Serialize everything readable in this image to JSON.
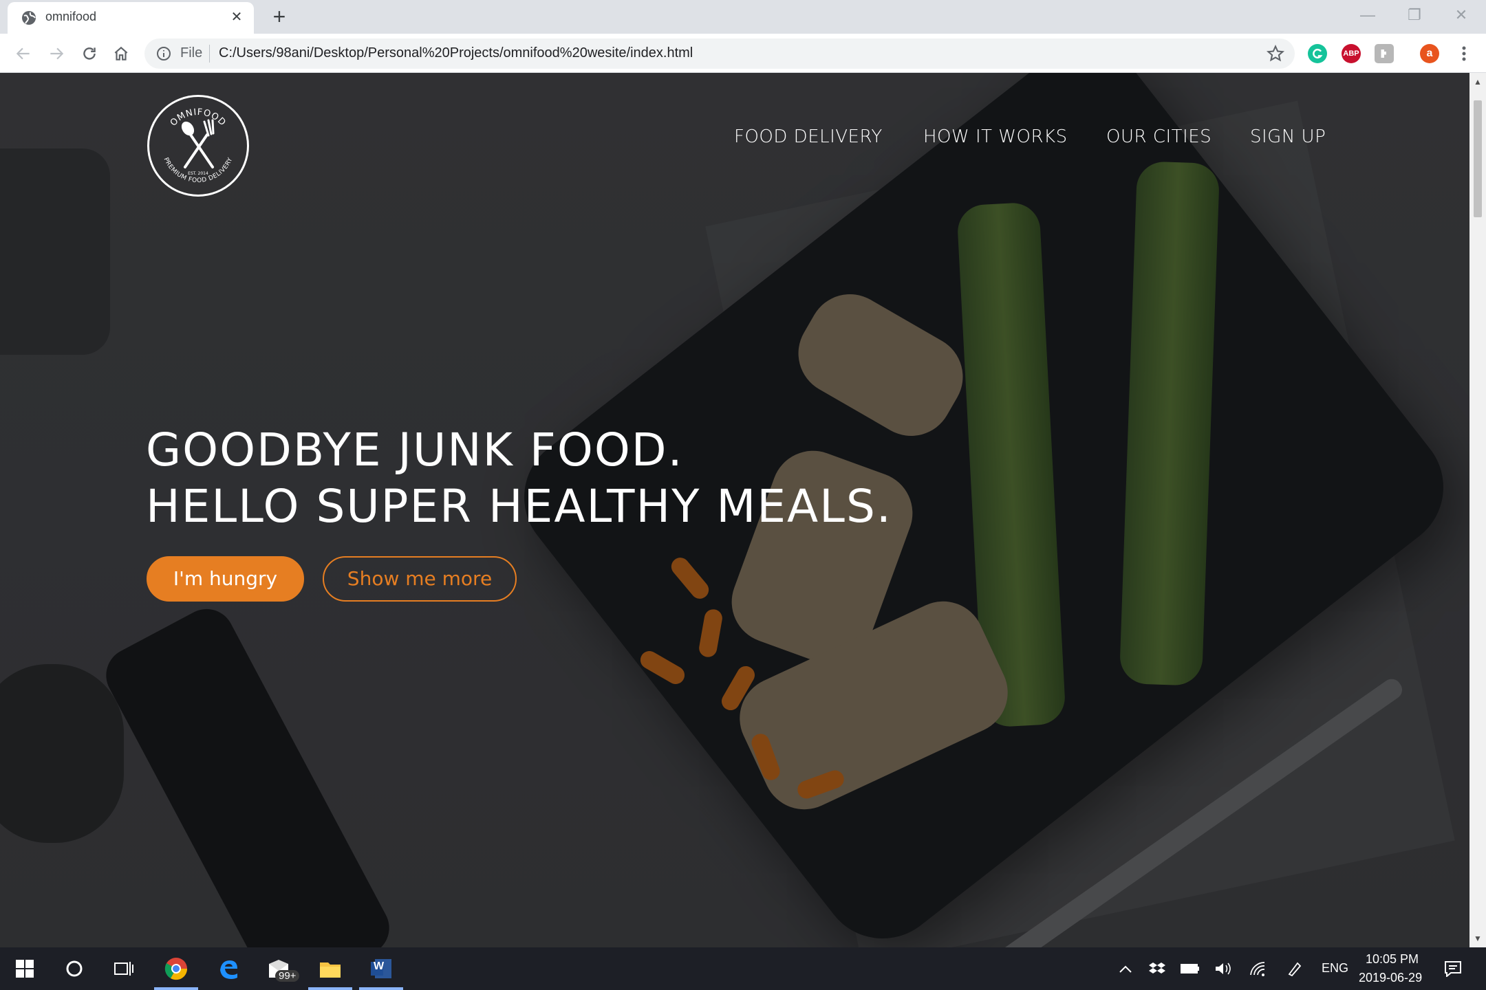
{
  "browser": {
    "tab_title": "omnifood",
    "tab_close_glyph": "✕",
    "new_tab_glyph": "+",
    "scheme_label": "File",
    "url": "C:/Users/98ani/Desktop/Personal%20Projects/omnifood%20wesite/index.html",
    "profile_initial": "a",
    "abp_label": "ABP",
    "window_minimize": "—",
    "window_restore": "❐",
    "window_close": "✕"
  },
  "page": {
    "nav": [
      "FOOD DELIVERY",
      "HOW IT WORKS",
      "OUR CITIES",
      "SIGN UP"
    ],
    "logo_text_top": "OMNIFOOD",
    "logo_text_bottom": "PREMIUM FOOD DELIVERY",
    "logo_est": "EST. 2014",
    "hero_line_1": "GOODBYE JUNK FOOD.",
    "hero_line_2": "HELLO SUPER HEALTHY MEALS.",
    "btn_primary": "I'm hungry",
    "btn_secondary": "Show me more",
    "accent_color": "#e67e22"
  },
  "taskbar": {
    "mail_badge": "99+",
    "language": "ENG",
    "time": "10:05 PM",
    "date": "2019-06-29",
    "word_label": "W"
  }
}
